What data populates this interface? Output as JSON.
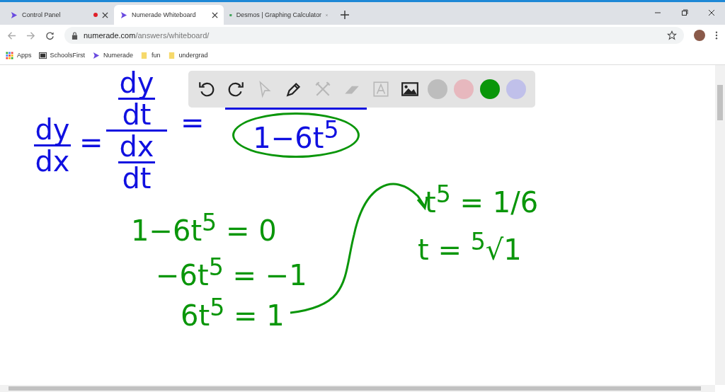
{
  "tabs": [
    {
      "title": "Control Panel",
      "selected": false,
      "recording": true
    },
    {
      "title": "Numerade Whiteboard",
      "selected": true,
      "recording": false
    },
    {
      "title": "Desmos | Graphing Calculator",
      "selected": false,
      "recording": false
    }
  ],
  "address": {
    "domain": "numerade.com",
    "path": "/answers/whiteboard/"
  },
  "bookmarks": [
    {
      "label": "Apps"
    },
    {
      "label": "SchoolsFirst"
    },
    {
      "label": "Numerade"
    },
    {
      "label": "fun"
    },
    {
      "label": "undergrad"
    }
  ],
  "toolbar": {
    "tools": [
      {
        "kind": "undo",
        "disabled": false
      },
      {
        "kind": "redo",
        "disabled": false
      },
      {
        "kind": "pointer",
        "disabled": true
      },
      {
        "kind": "pen",
        "disabled": false
      },
      {
        "kind": "tools",
        "disabled": true
      },
      {
        "kind": "eraser",
        "disabled": true
      },
      {
        "kind": "text",
        "disabled": true
      },
      {
        "kind": "image",
        "disabled": false
      }
    ],
    "colors": [
      {
        "color": "#b0b0b0",
        "selected": false
      },
      {
        "color": "#e8aab2",
        "selected": false
      },
      {
        "color": "#0a960a",
        "selected": true
      },
      {
        "color": "#b4b4ec",
        "selected": false
      }
    ]
  },
  "board": [
    {
      "kind": "fraction",
      "num": "dy",
      "den": "dx",
      "color": "#1010e0"
    },
    {
      "kind": "text",
      "text": "=",
      "color": "#1010e0"
    },
    {
      "kind": "compound",
      "num": [
        "dy",
        "dt"
      ],
      "den": [
        "dx",
        "dt"
      ],
      "color": "#1010e0"
    },
    {
      "kind": "text",
      "text": "=",
      "color": "#1010e0"
    },
    {
      "kind": "circled",
      "text": "1−6t$^{5}$",
      "color": "#1010e0"
    },
    {
      "kind": "text",
      "text": "1−6t$^{5}$ = 0",
      "color": "#0a960a"
    },
    {
      "kind": "text",
      "text": "−6t$^{5}$ = −1",
      "color": "#0a960a"
    },
    {
      "kind": "text",
      "text": "6t$^{5}$ = 1",
      "color": "#0a960a"
    },
    {
      "kind": "text",
      "text": "t$^{5}$ = 1/6",
      "color": "#0a960a"
    },
    {
      "kind": "text",
      "text": "t = $^{5}$√1",
      "color": "#0a960a"
    }
  ]
}
